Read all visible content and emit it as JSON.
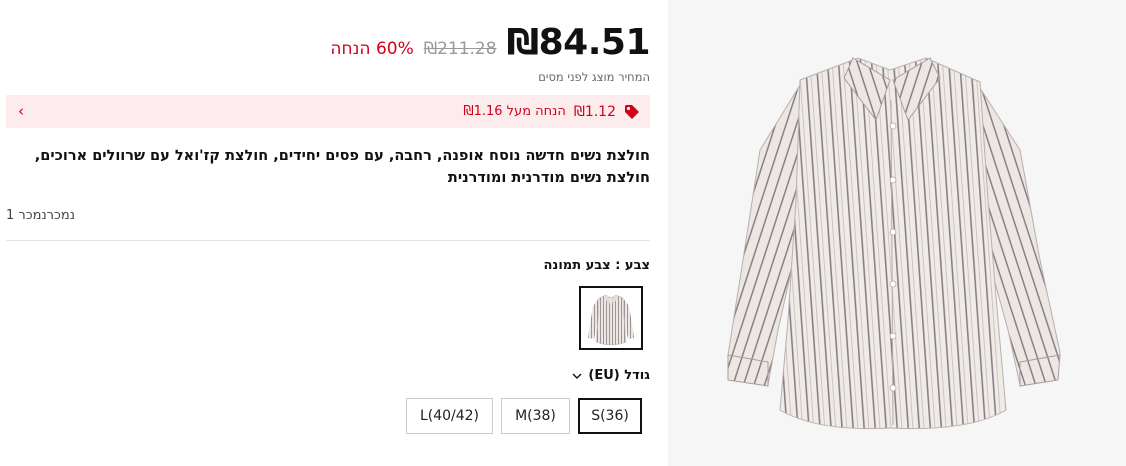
{
  "price": {
    "current": "₪84.51",
    "original": "₪211.28",
    "discount": "60% הנחה",
    "tax_note": "המחיר מוצג לפני מסים"
  },
  "promo": {
    "amount": "₪1.12",
    "text": "הנחה מעל ₪1.16",
    "chevron": "›",
    "icon": "tag-icon",
    "color": "#d0021b",
    "background": "#fdecee"
  },
  "product": {
    "title": "חולצת נשים חדשה נוסח אופנה, רחבה, עם פסים יחידים, חולצת קז'ואל עם שרוולים ארוכים, חולצת נשים מודרנית ומודרנית",
    "sold": "נמכרנמכר 1"
  },
  "color": {
    "label": "צבע : צבע תמונה"
  },
  "size": {
    "label": "גודל (EU)",
    "options": [
      "S(36)",
      "M(38)",
      "L(40/42)"
    ],
    "selected": "S(36)"
  }
}
